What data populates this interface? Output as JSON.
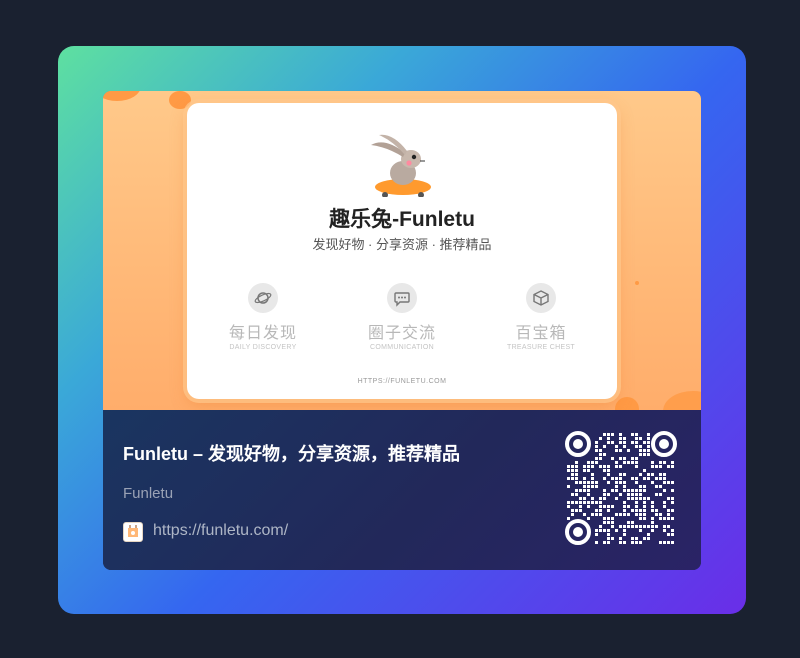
{
  "preview": {
    "site_title": "趣乐兔-Funletu",
    "tagline": "发现好物 · 分享资源 · 推荐精品",
    "features": [
      {
        "title": "每日发现",
        "subtitle": "DAILY DISCOVERY",
        "icon": "planet-icon"
      },
      {
        "title": "圈子交流",
        "subtitle": "COMMUNICATION",
        "icon": "chat-bubble-icon"
      },
      {
        "title": "百宝箱",
        "subtitle": "TREASURE CHEST",
        "icon": "box-icon"
      }
    ],
    "footer_url": "HTTPS://FUNLETU.COM",
    "mascot": "rabbit-skateboard-logo"
  },
  "card": {
    "title": "Funletu – 发现好物，分享资源，推荐精品",
    "site_name": "Funletu",
    "url": "https://funletu.com/"
  },
  "colors": {
    "background": "#1a2130",
    "hero_orange": "#ffb877",
    "footer_navy": "#1d2a55",
    "frame_gradient_start": "#5ee0a0",
    "frame_gradient_end": "#6a2ee8"
  }
}
